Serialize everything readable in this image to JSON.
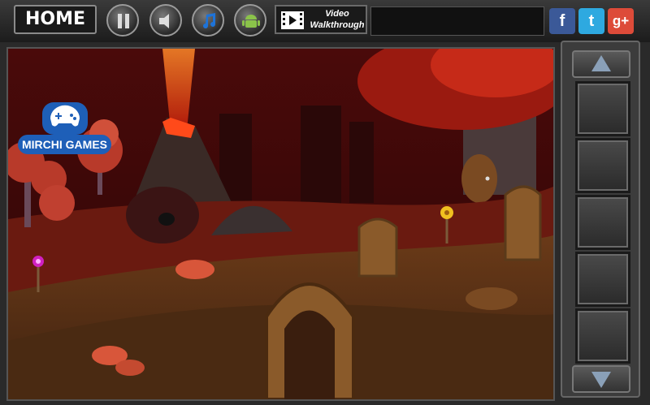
{
  "topbar": {
    "home_label": "HOME",
    "video_label_line1": "Video",
    "video_label_line2": "Walkthrough",
    "pause_icon": "pause-icon",
    "sound_icon": "speaker-icon",
    "music_icon": "music-note-icon",
    "android_icon": "android-icon"
  },
  "social": {
    "facebook": "f",
    "twitter": "t",
    "googleplus": "g+"
  },
  "logo": {
    "text": "MIRCHI GAMES"
  },
  "colors": {
    "sky": "#3a0707",
    "ground": "#5a3315",
    "lava": "#ff5a1a",
    "panel": "#3c3c3c",
    "facebook": "#3b5998",
    "twitter": "#2ea9e0",
    "googleplus": "#dd4b39"
  }
}
